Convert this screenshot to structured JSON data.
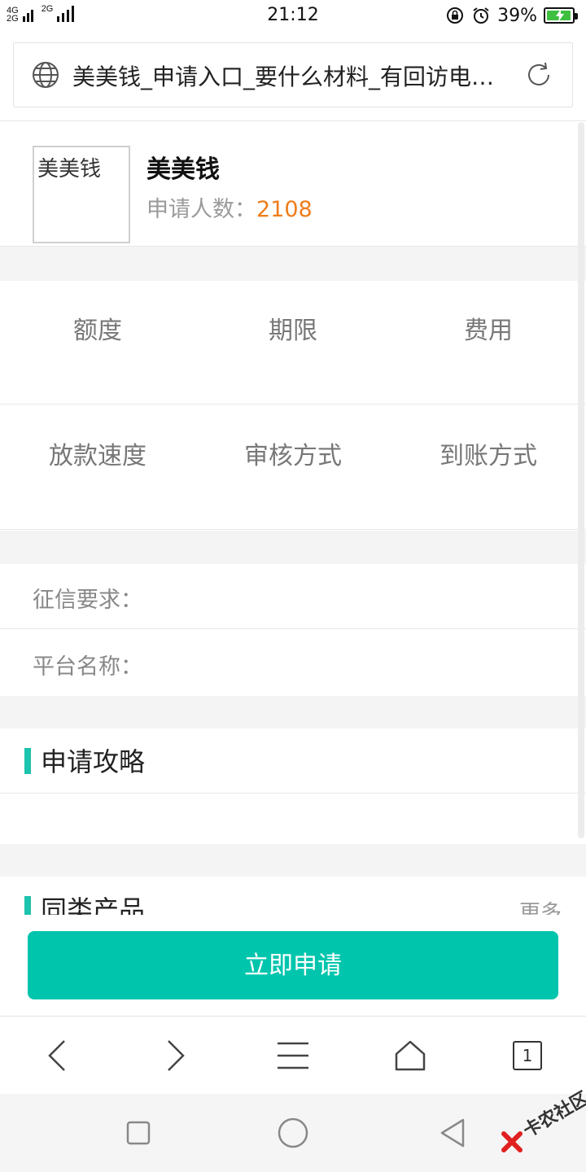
{
  "status_bar": {
    "signal_label_top": "4G",
    "signal_label_bottom": "2G",
    "signal_label_2": "2G",
    "time": "21:12",
    "battery_percent_text": "39%",
    "battery_level": 0.39
  },
  "address_bar": {
    "title": "美美钱_申请入口_要什么材料_有回访电话…"
  },
  "product": {
    "logo_text": "美美钱",
    "name": "美美钱",
    "applicants_label": "申请人数：",
    "applicants_count": "2108"
  },
  "grid": {
    "row1": [
      "额度",
      "期限",
      "费用"
    ],
    "row2": [
      "放款速度",
      "审核方式",
      "到账方式"
    ]
  },
  "info": {
    "credit_requirement_label": "征信要求：",
    "platform_name_label": "平台名称："
  },
  "sections": {
    "guide_title": "申请攻略",
    "similar_title": "同类产品",
    "similar_more": "更多"
  },
  "apply_button_label": "立即申请",
  "browser_nav": {
    "tab_count": "1"
  },
  "watermark": "卡农社区",
  "colors": {
    "accent": "#00c5ad",
    "count_orange": "#ef7d1a"
  }
}
